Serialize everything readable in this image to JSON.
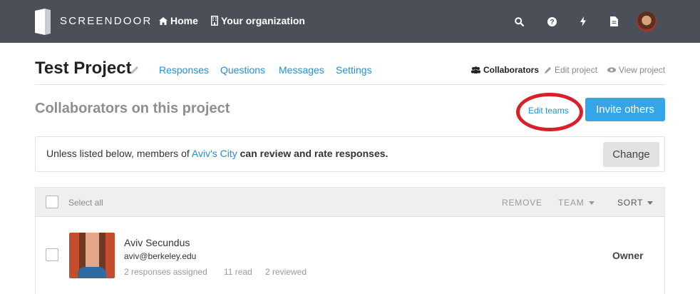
{
  "topbar": {
    "brand": "SCREENDOOR",
    "home_label": "Home",
    "org_label": "Your organization",
    "icons": [
      "home-icon",
      "building-icon",
      "search-icon",
      "help-icon",
      "bolt-icon",
      "document-icon",
      "avatar"
    ]
  },
  "project": {
    "title": "Test Project",
    "tabs": [
      {
        "label": "Responses"
      },
      {
        "label": "Questions"
      },
      {
        "label": "Messages"
      },
      {
        "label": "Settings"
      }
    ],
    "right_links": {
      "collaborators": "Collaborators",
      "edit_project": "Edit project",
      "view_project": "View project"
    }
  },
  "collaborators": {
    "title": "Collaborators on this project",
    "edit_teams": "Edit teams",
    "invite_button": "Invite others",
    "highlight_color": "#d8202a"
  },
  "notice": {
    "prefix": "Unless listed below, members of ",
    "org_link": "Aviv's City",
    "suffix": "can review and rate responses.",
    "change_button": "Change"
  },
  "table": {
    "select_all": "Select all",
    "remove": "REMOVE",
    "team": "TEAM",
    "sort": "SORT",
    "rows": [
      {
        "name": "Aviv Secundus",
        "email": "aviv@berkeley.edu",
        "assigned": "2 responses assigned",
        "read": "11 read",
        "reviewed": "2 reviewed",
        "role": "Owner"
      }
    ]
  },
  "colors": {
    "topbar_bg": "#4b5058",
    "link": "#2a8ec9",
    "primary_button": "#34a6e8"
  }
}
